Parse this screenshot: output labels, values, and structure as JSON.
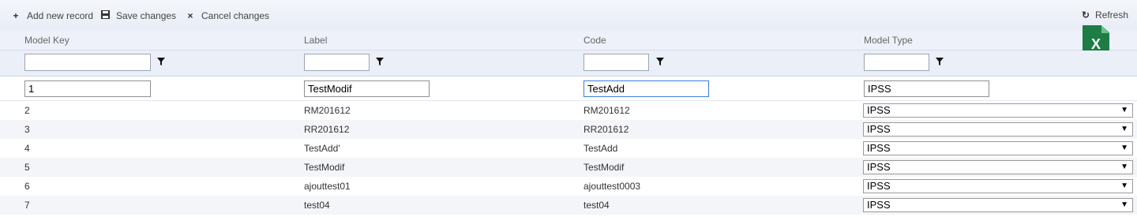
{
  "toolbar": {
    "add_label": "Add new record",
    "add_icon": "+",
    "save_label": "Save changes",
    "save_icon": "💾",
    "cancel_label": "Cancel changes",
    "cancel_icon": "×",
    "refresh_label": "Refresh",
    "refresh_icon": "↻"
  },
  "columns": [
    "Model Key",
    "Label",
    "Code",
    "Model Type"
  ],
  "filters": [
    "",
    "",
    "",
    ""
  ],
  "export": {
    "label": "X",
    "icon": "excel-export-icon"
  },
  "edit_row": {
    "model_key": "1",
    "label": "TestModif",
    "code": "TestAdd",
    "model_type": "IPSS"
  },
  "rows": [
    {
      "model_key": "2",
      "label": "RM201612",
      "code": "RM201612",
      "model_type": "IPSS"
    },
    {
      "model_key": "3",
      "label": "RR201612",
      "code": "RR201612",
      "model_type": "IPSS"
    },
    {
      "model_key": "4",
      "label": "TestAdd'",
      "code": "TestAdd",
      "model_type": "IPSS"
    },
    {
      "model_key": "5",
      "label": "TestModif",
      "code": "TestModif",
      "model_type": "IPSS"
    },
    {
      "model_key": "6",
      "label": "ajouttest01",
      "code": "ajouttest0003",
      "model_type": "IPSS"
    },
    {
      "model_key": "7",
      "label": "test04",
      "code": "test04",
      "model_type": "IPSS"
    }
  ],
  "colors": {
    "accent": "#3b7de0",
    "excel": "#1e7d45"
  }
}
